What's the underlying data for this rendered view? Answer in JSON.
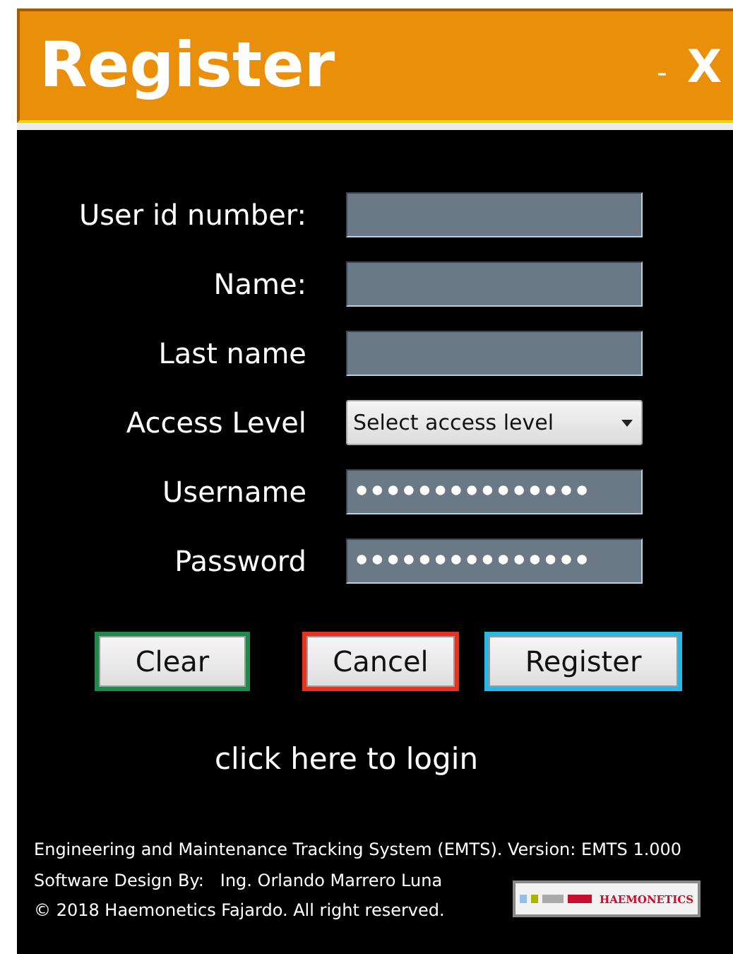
{
  "window": {
    "title": "Register",
    "minimize": "-",
    "close": "X"
  },
  "fields": [
    {
      "label": "User id number:",
      "kind": "text"
    },
    {
      "label": "Name:",
      "kind": "text"
    },
    {
      "label": "Last name",
      "kind": "text"
    },
    {
      "label": "Access Level",
      "kind": "select",
      "value": "Select access level"
    },
    {
      "label": "Username",
      "kind": "password",
      "value": "•••••••••••••••"
    },
    {
      "label": "Password",
      "kind": "password",
      "value": "•••••••••••••••"
    }
  ],
  "buttons": [
    {
      "label": "Clear",
      "color": "#1e8a4a"
    },
    {
      "label": "Cancel",
      "color": "#e8321e"
    },
    {
      "label": "Register",
      "color": "#28b8e8"
    }
  ],
  "login_link": "click here to login",
  "footer": {
    "lines": [
      "Engineering and Maintenance Tracking System (EMTS). Version: EMTS 1.000",
      "Software Design By:   Ing. Orlando Marrero Luna",
      "© 2018 Haemonetics Fajardo. All right reserved."
    ],
    "logo": "HAEMONETICS"
  }
}
